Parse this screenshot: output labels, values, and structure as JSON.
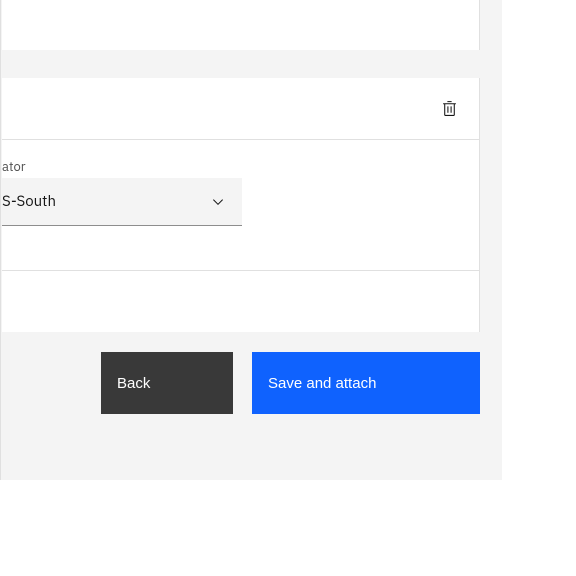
{
  "field": {
    "label": "ator",
    "selectedValue": "S-South"
  },
  "buttons": {
    "back": "Back",
    "save": "Save and attach"
  }
}
